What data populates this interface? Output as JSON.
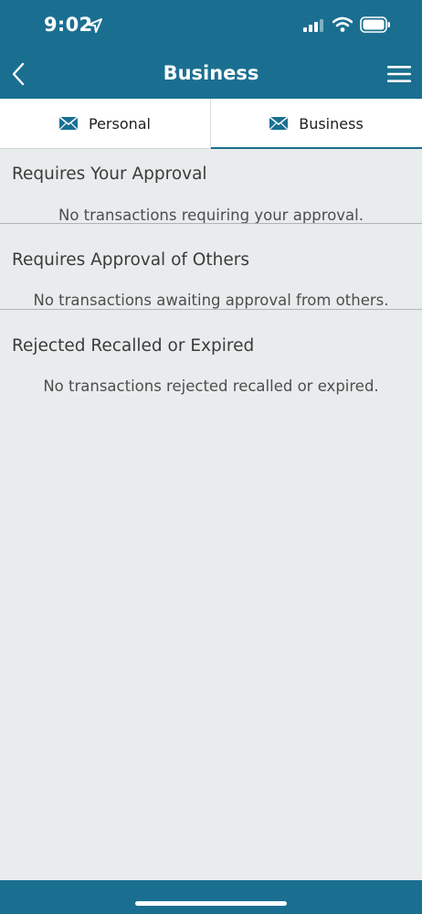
{
  "status_bar": {
    "time": "9:02"
  },
  "header": {
    "title": "Business"
  },
  "tabs": [
    {
      "label": "Personal",
      "active": false
    },
    {
      "label": "Business",
      "active": true
    }
  ],
  "sections": [
    {
      "title": "Requires Your Approval",
      "message": "No transactions requiring your approval."
    },
    {
      "title": "Requires Approval of Others",
      "message": "No transactions awaiting approval from others."
    },
    {
      "title": "Rejected Recalled or Expired",
      "message": "No transactions rejected recalled or expired."
    }
  ],
  "colors": {
    "accent": "#1a6f91",
    "background": "#e9eced"
  }
}
